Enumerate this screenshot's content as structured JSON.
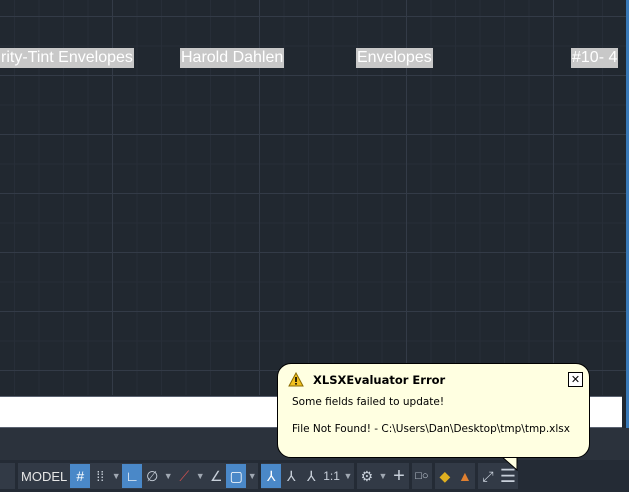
{
  "drawing": {
    "labels": [
      "rity-Tint Envelopes",
      "Harold Dahlen",
      "Envelopes",
      "#10- 4"
    ]
  },
  "statusbar": {
    "model": "MODEL",
    "scale": "1:1"
  },
  "balloon": {
    "title": "XLSXEvaluator Error",
    "line1": "Some fields failed to update!",
    "line2": "File Not Found! - C:\\Users\\Dan\\Desktop\\tmp\\tmp.xlsx",
    "close": "✕"
  }
}
